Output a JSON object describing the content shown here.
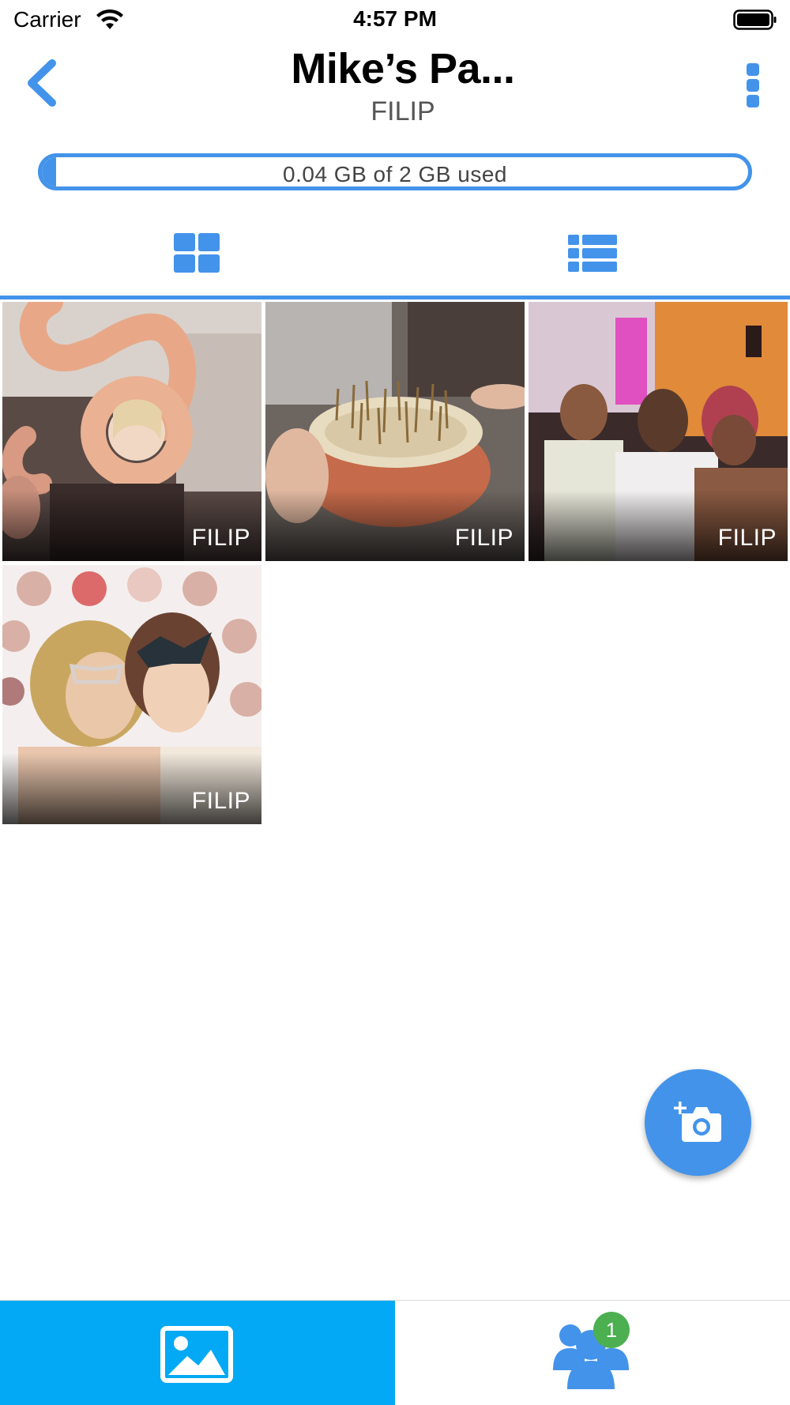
{
  "status_bar": {
    "carrier": "Carrier",
    "time": "4:57 PM"
  },
  "nav": {
    "title": "Mike’s Pa...",
    "subtitle": "FILIP"
  },
  "storage": {
    "label": "0.04 GB of 2 GB used",
    "used_gb": 0.04,
    "total_gb": 2,
    "used_fraction": 0.02
  },
  "view_toggle": {
    "active": "grid",
    "options": [
      "grid",
      "list"
    ]
  },
  "photos": [
    {
      "owner": "FILIP",
      "subject": "girl with number 5 balloon"
    },
    {
      "owner": "FILIP",
      "subject": "birthday cake with candles"
    },
    {
      "owner": "FILIP",
      "subject": "friends at party"
    },
    {
      "owner": "FILIP",
      "subject": "photo booth masks"
    }
  ],
  "tabbar": {
    "active": "photos",
    "people_badge": "1"
  },
  "colors": {
    "accent": "#4393ea",
    "tab_active_bg": "#03a9f4",
    "badge": "#4caf50"
  },
  "icons": {
    "back": "chevron-left-icon",
    "more": "more-vertical-icon",
    "grid": "grid-view-icon",
    "list": "list-view-icon",
    "fab": "add-photo-camera-icon",
    "tab_photos": "image-icon",
    "tab_people": "people-icon"
  }
}
